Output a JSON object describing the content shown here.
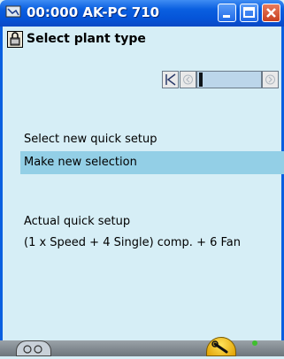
{
  "window": {
    "title": "00:000 AK-PC 710"
  },
  "header": {
    "title": "Select plant type"
  },
  "main": {
    "select_label": "Select new quick setup",
    "selection_value": "Make new selection",
    "actual_label": "Actual quick setup",
    "actual_value": "(1 x Speed + 4 Single) comp. + 6 Fan"
  },
  "colors": {
    "titlebar": "#0a5fe0",
    "background": "#d6eef6",
    "selection_highlight": "#93cfe6"
  },
  "icons": {
    "app": "network-icon",
    "header": "lock-icon",
    "nav": [
      "first-page-icon",
      "prev-page-icon",
      "next-page-icon"
    ],
    "bottom": [
      "controller-icon",
      "wrench-icon",
      "status-dot-icon"
    ]
  }
}
